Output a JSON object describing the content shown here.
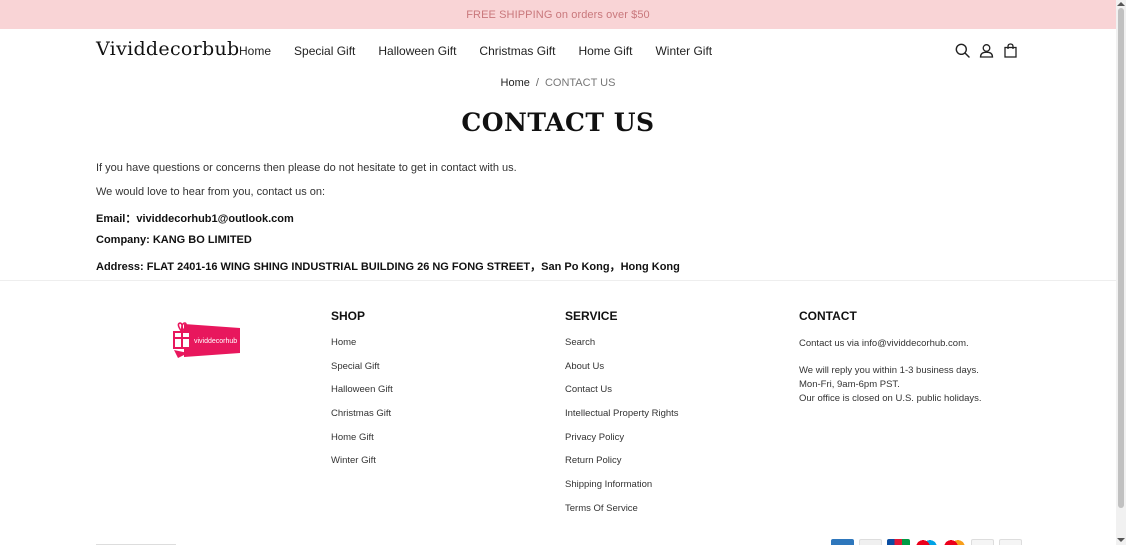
{
  "announcement": "FREE SHIPPING on orders over $50",
  "header": {
    "logo": "Vividdecorbub",
    "nav": [
      "Home",
      "Special Gift",
      "Halloween Gift",
      "Christmas Gift",
      "Home Gift",
      "Winter Gift"
    ],
    "icons": [
      "search-icon",
      "account-icon",
      "cart-icon"
    ]
  },
  "breadcrumb": {
    "home": "Home",
    "separator": "/",
    "current": "CONTACT US"
  },
  "page_title": "CONTACT US",
  "content": {
    "line1": "If you have questions or concerns then please do not hesitate to get in contact with us.",
    "line2": "We would love to hear from you, contact us on:",
    "email": "Email：vividdecorhub1@outlook.com",
    "company": "Company: KANG BO LIMITED",
    "address": "Address: FLAT 2401-16 WING SHING INDUSTRIAL BUILDING 26 NG FONG STREET，San Po Kong，Hong Kong"
  },
  "footer": {
    "logo_text": "vividdecorhub",
    "shop": {
      "title": "SHOP",
      "links": [
        "Home",
        "Special Gift",
        "Halloween Gift",
        "Christmas Gift",
        "Home Gift",
        "Winter Gift"
      ]
    },
    "service": {
      "title": "SERVICE",
      "links": [
        "Search",
        "About Us",
        "Contact Us",
        "Intellectual Property Rights",
        "Privacy Policy",
        "Return Policy",
        "Shipping Information",
        "Terms Of Service"
      ]
    },
    "contact": {
      "title": "CONTACT",
      "line1": "Contact us via info@vividdecorhub.com.",
      "line2": "We will reply you within 1-3 business days.",
      "line3": "Mon-Fri, 9am-6pm PST.",
      "line4": "Our office is closed on U.S. public holidays."
    }
  },
  "colors": {
    "announcement_bg": "#f9d4d6",
    "brand_pink": "#e8175d"
  }
}
